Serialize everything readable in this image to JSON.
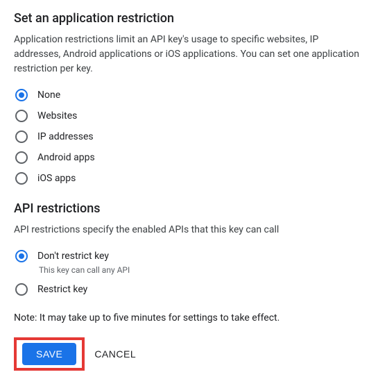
{
  "app_restriction": {
    "title": "Set an application restriction",
    "description": "Application restrictions limit an API key's usage to specific websites, IP addresses, Android applications or iOS applications. You can set one application restriction per key.",
    "options": [
      {
        "label": "None",
        "selected": true
      },
      {
        "label": "Websites",
        "selected": false
      },
      {
        "label": "IP addresses",
        "selected": false
      },
      {
        "label": "Android apps",
        "selected": false
      },
      {
        "label": "iOS apps",
        "selected": false
      }
    ]
  },
  "api_restriction": {
    "title": "API restrictions",
    "description": "API restrictions specify the enabled APIs that this key can call",
    "options": [
      {
        "label": "Don't restrict key",
        "sub": "This key can call any API",
        "selected": true
      },
      {
        "label": "Restrict key",
        "selected": false
      }
    ]
  },
  "note": "Note: It may take up to five minutes for settings to take effect.",
  "buttons": {
    "save": "SAVE",
    "cancel": "CANCEL"
  }
}
